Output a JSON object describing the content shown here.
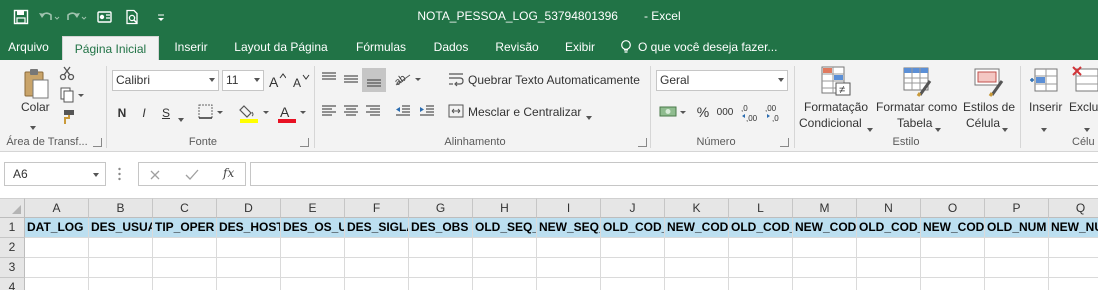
{
  "window": {
    "file_name": "NOTA_PESSOA_LOG_53794801396",
    "app_name": "- Excel"
  },
  "quick_access": [
    "save-icon",
    "undo-icon",
    "redo-icon",
    "touch-mode-icon",
    "print-preview-icon",
    "customize-qat-icon"
  ],
  "tabs": [
    {
      "label": "Arquivo"
    },
    {
      "label": "Página Inicial",
      "active": true
    },
    {
      "label": "Inserir"
    },
    {
      "label": "Layout da Página"
    },
    {
      "label": "Fórmulas"
    },
    {
      "label": "Dados"
    },
    {
      "label": "Revisão"
    },
    {
      "label": "Exibir"
    }
  ],
  "tell_me": "O que você deseja fazer...",
  "ribbon": {
    "clipboard": {
      "paste_label": "Colar",
      "group_label": "Área de Transf..."
    },
    "font": {
      "name": "Calibri",
      "size": "11",
      "bold": "N",
      "italic": "I",
      "underline": "S",
      "group_label": "Fonte"
    },
    "alignment": {
      "wrap_text": "Quebrar Texto Automaticamente",
      "merge_center": "Mesclar e Centralizar",
      "group_label": "Alinhamento"
    },
    "number": {
      "format": "Geral",
      "group_label": "Número"
    },
    "styles": {
      "conditional_line1": "Formatação",
      "conditional_line2": "Condicional",
      "table_line1": "Formatar como",
      "table_line2": "Tabela",
      "cell_styles_line1": "Estilos de",
      "cell_styles_line2": "Célula",
      "group_label": "Estilo"
    },
    "cells": {
      "insert_label": "Inserir",
      "delete_label": "Exclu",
      "group_label": "Célu"
    }
  },
  "formula_bar": {
    "name_box": "A6",
    "fx": "fx",
    "value": ""
  },
  "sheet": {
    "columns": [
      "A",
      "B",
      "C",
      "D",
      "E",
      "F",
      "G",
      "H",
      "I",
      "J",
      "K",
      "L",
      "M",
      "N",
      "O",
      "P",
      "Q"
    ],
    "rows": [
      "1",
      "2",
      "3",
      "4"
    ],
    "header_row": [
      "DAT_LOG",
      "DES_USUA",
      "TIP_OPER",
      "DES_HOST",
      "DES_OS_U",
      "DES_SIGLA",
      "DES_OBS",
      "OLD_SEQ_",
      "NEW_SEQ_",
      "OLD_COD_",
      "NEW_COD_",
      "OLD_COD_",
      "NEW_COD_",
      "OLD_COD_",
      "NEW_COD_",
      "OLD_NUM",
      "NEW_NU"
    ]
  },
  "colors": {
    "brand": "#217346",
    "header_fill": "#bcdff0"
  }
}
